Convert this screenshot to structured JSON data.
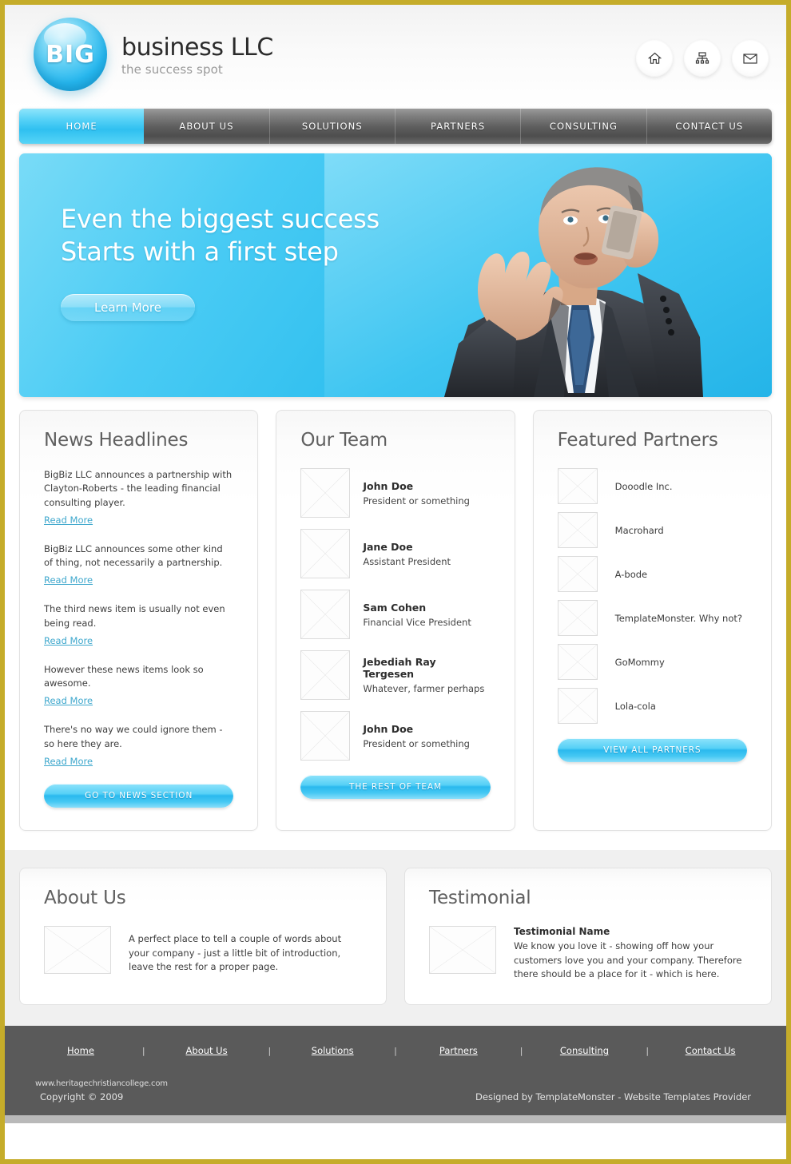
{
  "header": {
    "logo_badge": "BIG",
    "logo_title": "business LLC",
    "logo_tagline": "the success spot",
    "icons": [
      {
        "name": "home-icon",
        "label": "Home"
      },
      {
        "name": "sitemap-icon",
        "label": "Sitemap"
      },
      {
        "name": "mail-icon",
        "label": "Contact"
      }
    ]
  },
  "nav": {
    "items": [
      {
        "label": "HOME",
        "active": true
      },
      {
        "label": "ABOUT US",
        "active": false
      },
      {
        "label": "SOLUTIONS",
        "active": false
      },
      {
        "label": "PARTNERS",
        "active": false
      },
      {
        "label": "CONSULTING",
        "active": false
      },
      {
        "label": "CONTACT US",
        "active": false
      }
    ]
  },
  "hero": {
    "line1": "Even the biggest success",
    "line2": "Starts with a first step",
    "button": "Learn More",
    "image_alt": "businessman-on-phone"
  },
  "news": {
    "title": "News Headlines",
    "read_more_label": "Read More",
    "button": "GO TO NEWS SECTION",
    "items": [
      {
        "text": "BigBiz LLC announces a partnership with Clayton-Roberts - the leading financial consulting player."
      },
      {
        "text": "BigBiz LLC announces some other kind of thing, not necessarily a partnership."
      },
      {
        "text": "The third news item is usually not even being read."
      },
      {
        "text": "However these news items look so awesome."
      },
      {
        "text": "There's no way  we could ignore them - so here they are."
      }
    ]
  },
  "team": {
    "title": "Our Team",
    "button": "THE REST OF TEAM",
    "members": [
      {
        "name": "John Doe",
        "role": "President or something"
      },
      {
        "name": "Jane Doe",
        "role": "Assistant President"
      },
      {
        "name": "Sam Cohen",
        "role": "Financial Vice President"
      },
      {
        "name": "Jebediah Ray Tergesen",
        "role": "Whatever, farmer perhaps"
      },
      {
        "name": "John Doe",
        "role": "President or something"
      }
    ]
  },
  "partners": {
    "title": "Featured Partners",
    "button": "VIEW ALL PARTNERS",
    "items": [
      {
        "name": "Dooodle Inc."
      },
      {
        "name": "Macrohard"
      },
      {
        "name": "A-bode"
      },
      {
        "name": "TemplateMonster. Why not?"
      },
      {
        "name": "GoMommy"
      },
      {
        "name": "Lola-cola"
      }
    ]
  },
  "about": {
    "title": "About Us",
    "text": "A perfect place to tell a couple of words about your company - just a little bit of introduction, leave the rest for a proper page."
  },
  "testimonial": {
    "title": "Testimonial",
    "name": "Testimonial Name",
    "text": "We know you love it - showing off how your customers love you and your company. Therefore there should be a place for it - which is here."
  },
  "footer": {
    "links": [
      {
        "label": "Home"
      },
      {
        "label": "About Us"
      },
      {
        "label": "Solutions"
      },
      {
        "label": "Partners"
      },
      {
        "label": "Consulting"
      },
      {
        "label": "Contact Us"
      }
    ],
    "separator": "|",
    "copyright": "Copyright © 2009",
    "designed_by": "Designed by TemplateMonster - Website Templates Provider",
    "watermark": "www.heritagechristiancollege.com"
  },
  "colors": {
    "accent_cyan": "#2bbdee",
    "nav_dark": "#5e5e5e",
    "footer_gray": "#5a5a5a",
    "link_blue": "#3fa8cd",
    "page_border": "#c5ac2a"
  }
}
